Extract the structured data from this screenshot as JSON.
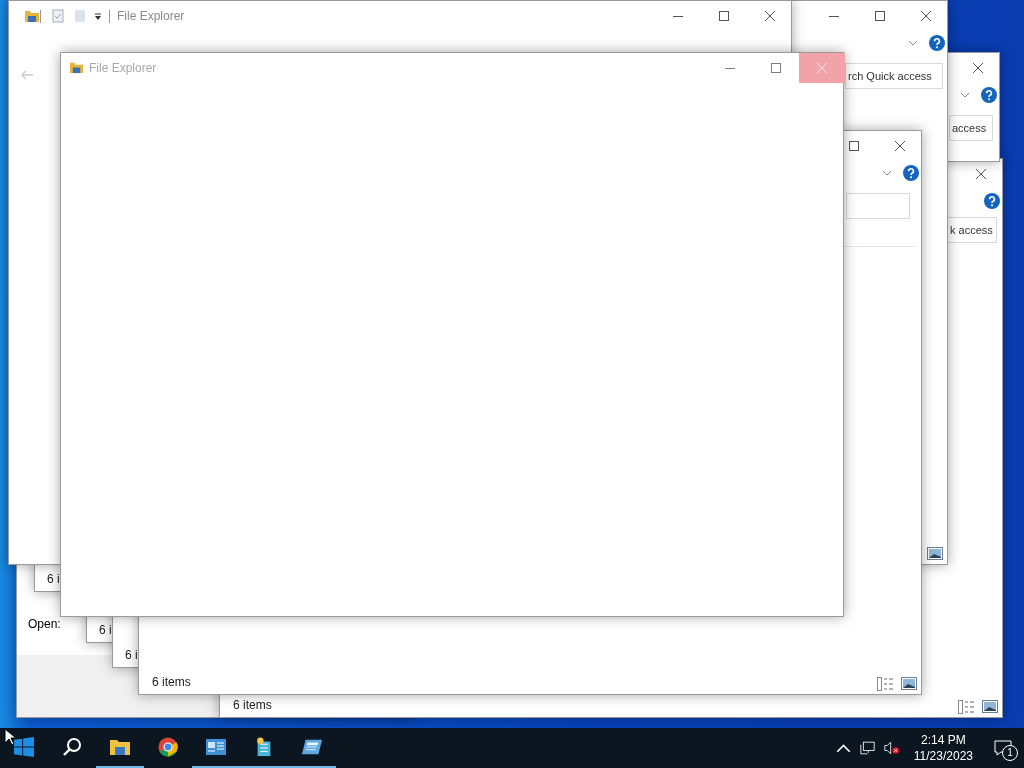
{
  "windows": [
    {
      "kind": "run",
      "open_label": "Open:"
    },
    {
      "kind": "explorer",
      "search_text": "k access",
      "status": "6 items",
      "close_hovered": false
    },
    {
      "kind": "stub",
      "status": "6 i"
    },
    {
      "kind": "stub",
      "status": "6 i"
    },
    {
      "kind": "stub",
      "status": "6 i"
    },
    {
      "kind": "explorer",
      "search_text": "access",
      "close_hovered": false
    },
    {
      "kind": "explorer",
      "search_text": "rch Quick access",
      "close_hovered": false
    },
    {
      "kind": "explorer",
      "status": "6 items",
      "close_hovered": false
    },
    {
      "kind": "explorer",
      "title": "File Explorer",
      "close_hovered": false
    },
    {
      "kind": "explorer",
      "title": "File Explorer",
      "close_hovered": true
    }
  ],
  "taskbar": {
    "apps": [
      {
        "kind": "start",
        "running": false
      },
      {
        "kind": "search",
        "running": false
      },
      {
        "kind": "folder",
        "running": true
      },
      {
        "kind": "chrome",
        "running": false
      },
      {
        "kind": "server",
        "running": true
      },
      {
        "kind": "box",
        "running": true
      },
      {
        "kind": "window",
        "running": true
      }
    ],
    "volume_muted": true,
    "time": "2:14 PM",
    "date": "11/23/2023",
    "notifications": "1"
  }
}
